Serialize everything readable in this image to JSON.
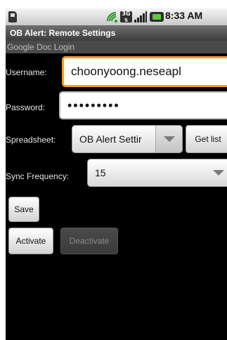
{
  "status_bar": {
    "time": "8:33 AM",
    "icons": [
      "sd-card-icon",
      "wifi-icon",
      "3g-icon",
      "signal-icon",
      "battery-icon"
    ],
    "network": "3G"
  },
  "app": {
    "title": "OB Alert: Remote Settings"
  },
  "section": {
    "header": "Google Doc Login"
  },
  "form": {
    "username_label": "Username:",
    "username_value": "choonyoong.neseapl",
    "password_label": "Password:",
    "password_value": "•••••••••",
    "spreadsheet_label": "Spreadsheet:",
    "spreadsheet_value": "OB Alert Settir",
    "get_list_label": "Get list",
    "sync_label": "Sync Frequency:",
    "sync_value": "15"
  },
  "buttons": {
    "save": "Save",
    "activate": "Activate",
    "deactivate": "Deactivate"
  },
  "colors": {
    "focus": "#ff9a1a",
    "background": "#000000"
  }
}
